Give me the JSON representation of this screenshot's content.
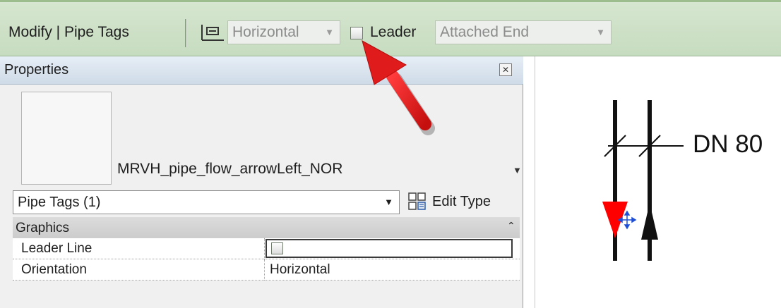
{
  "option_bar": {
    "context_label": "Modify | Pipe Tags",
    "orientation_value": "Horizontal",
    "leader_label": "Leader",
    "leader_checked": false,
    "leader_end_value": "Attached End",
    "orientation_icon": "tag-orientation-icon"
  },
  "properties": {
    "title": "Properties",
    "close_icon": "close-icon",
    "type_name": "MRVH_pipe_flow_arrowLeft_NOR",
    "filter_value": "Pipe Tags (1)",
    "edit_type_label": "Edit Type",
    "edit_type_icon": "edit-type-icon",
    "group": {
      "name": "Graphics",
      "collapse_glyph": "⌃"
    },
    "rows": [
      {
        "name": "Leader Line",
        "value": "",
        "checked": false
      },
      {
        "name": "Orientation",
        "value": "Horizontal"
      }
    ]
  },
  "canvas": {
    "tag_text": "DN 80"
  },
  "colors": {
    "option_bar_bg": "#cfe2c9",
    "annotation_arrow": "#e01b1b",
    "flow_arrow_red": "#ff0000",
    "grip_blue": "#1f4fd6"
  }
}
